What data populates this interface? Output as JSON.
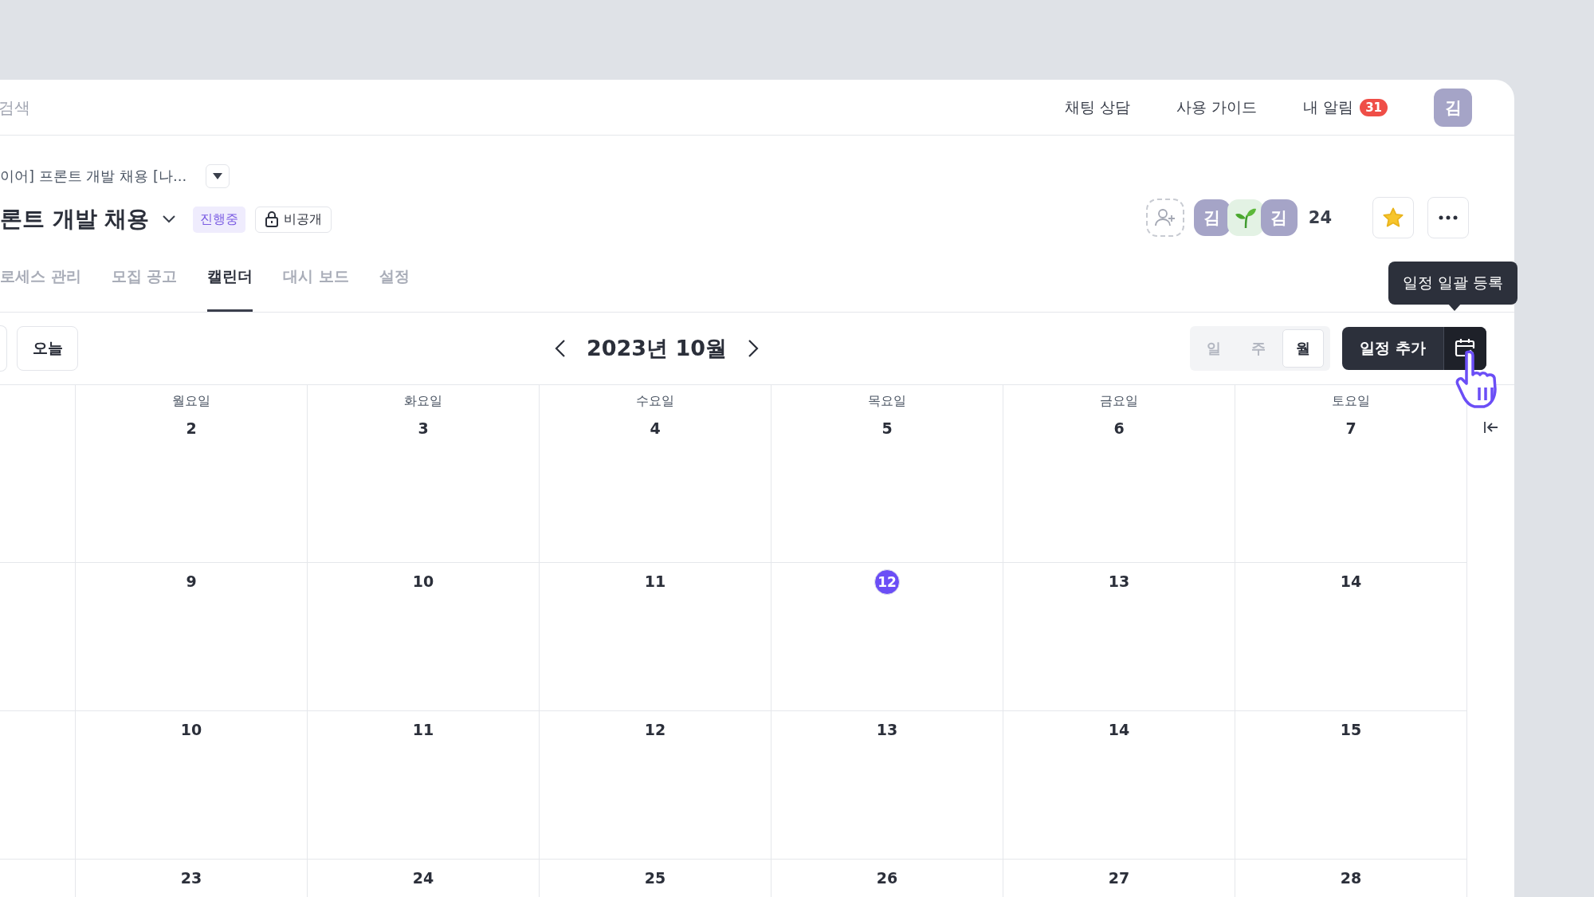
{
  "top_bar": {
    "search": {
      "placeholder": "검색"
    },
    "links": [
      {
        "label": "채팅 상담"
      },
      {
        "label": "사용 가이드"
      },
      {
        "label": "내 알림",
        "badge": "31"
      }
    ],
    "avatar": "김"
  },
  "project": {
    "breadcrumb": "이어] 프론트 개발 채용 [나...",
    "title": "론트 개발 채용",
    "status": "진행중",
    "visibility": "비공개",
    "members": [
      {
        "kind": "initial",
        "label": "김"
      },
      {
        "kind": "sprout"
      },
      {
        "kind": "initial",
        "label": "김"
      }
    ],
    "member_count": "24",
    "starred": true
  },
  "tabs": [
    {
      "label": "로세스 관리",
      "selected": false
    },
    {
      "label": "모집 공고",
      "selected": false
    },
    {
      "label": "캘린더",
      "selected": true
    },
    {
      "label": "대시 보드",
      "selected": false
    },
    {
      "label": "설정",
      "selected": false
    }
  ],
  "toolbar": {
    "today": "오늘",
    "month": "2023년 10월",
    "views": [
      {
        "label": "일",
        "selected": false
      },
      {
        "label": "주",
        "selected": false
      },
      {
        "label": "월",
        "selected": true
      }
    ],
    "add_button": "일정 추가",
    "tooltip": "일정 일괄 등록"
  },
  "calendar": {
    "weekdays": [
      "월요일",
      "화요일",
      "수요일",
      "목요일",
      "금요일",
      "토요일"
    ],
    "weeks": [
      [
        {
          "day": "2",
          "today": false
        },
        {
          "day": "3",
          "today": false
        },
        {
          "day": "4",
          "today": false
        },
        {
          "day": "5",
          "today": false
        },
        {
          "day": "6",
          "today": false
        },
        {
          "day": "7",
          "today": false
        }
      ],
      [
        {
          "day": "9",
          "today": false
        },
        {
          "day": "10",
          "today": false
        },
        {
          "day": "11",
          "today": false
        },
        {
          "day": "12",
          "today": true
        },
        {
          "day": "13",
          "today": false
        },
        {
          "day": "14",
          "today": false
        }
      ],
      [
        {
          "day": "10",
          "today": false
        },
        {
          "day": "11",
          "today": false
        },
        {
          "day": "12",
          "today": false
        },
        {
          "day": "13",
          "today": false
        },
        {
          "day": "14",
          "today": false
        },
        {
          "day": "15",
          "today": false
        }
      ],
      [
        {
          "day": "23",
          "today": false
        },
        {
          "day": "24",
          "today": false
        },
        {
          "day": "25",
          "today": false
        },
        {
          "day": "26",
          "today": false
        },
        {
          "day": "27",
          "today": false
        },
        {
          "day": "28",
          "today": false
        }
      ]
    ]
  }
}
